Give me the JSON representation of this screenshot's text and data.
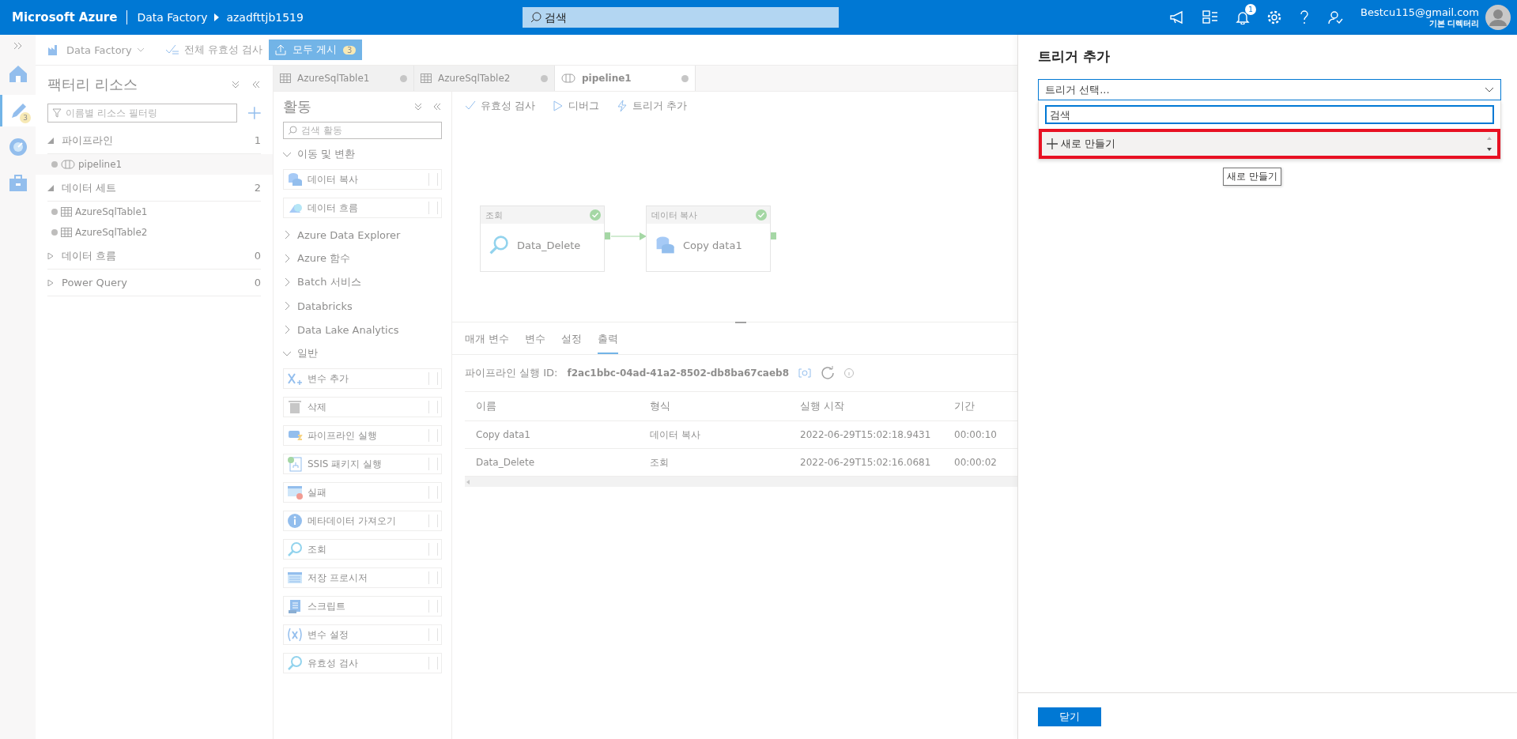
{
  "topbar": {
    "brand": "Microsoft Azure",
    "breadcrumb": [
      "Data Factory",
      "azadfttjb1519"
    ],
    "search_placeholder": "검색",
    "notification_count": "1",
    "user_email": "Bestcu115@gmail.com",
    "user_directory": "기본 디렉터리"
  },
  "rail": [
    {
      "kind": "home",
      "selected": false
    },
    {
      "kind": "author",
      "selected": true,
      "badge": "3"
    },
    {
      "kind": "monitor",
      "selected": false
    },
    {
      "kind": "manage",
      "selected": false
    }
  ],
  "toolbar": {
    "factory": "Data Factory",
    "validate_all": "전체 유효성 검사",
    "publish_all": "모두 게시",
    "publish_count": "3"
  },
  "factory_resources": {
    "title": "팩터리 리소스",
    "filter_placeholder": "이름별 리소스 필터링",
    "groups": [
      {
        "name": "파이프라인",
        "count": "1",
        "expanded": true,
        "children": [
          {
            "name": "pipeline1",
            "kind": "pipeline",
            "selected": true
          }
        ]
      },
      {
        "name": "데이터 세트",
        "count": "2",
        "expanded": true,
        "children": [
          {
            "name": "AzureSqlTable1",
            "kind": "dataset",
            "selected": false
          },
          {
            "name": "AzureSqlTable2",
            "kind": "dataset",
            "selected": false
          }
        ]
      },
      {
        "name": "데이터 흐름",
        "count": "0",
        "expanded": false
      },
      {
        "name": "Power Query",
        "count": "0",
        "expanded": false
      }
    ]
  },
  "tabs": [
    {
      "label": "AzureSqlTable1",
      "kind": "dataset",
      "selected": false
    },
    {
      "label": "AzureSqlTable2",
      "kind": "dataset",
      "selected": false
    },
    {
      "label": "pipeline1",
      "kind": "pipeline",
      "selected": true
    }
  ],
  "activities": {
    "title": "활동",
    "search_placeholder": "검색 활동",
    "categories": [
      {
        "name": "이동 및 변환",
        "expanded": true,
        "children": [
          {
            "name": "데이터 복사",
            "kind": "copy"
          },
          {
            "name": "데이터 흐름",
            "kind": "dataflow"
          }
        ]
      },
      {
        "name": "Azure Data Explorer",
        "expanded": false
      },
      {
        "name": "Azure 함수",
        "expanded": false
      },
      {
        "name": "Batch 서비스",
        "expanded": false
      },
      {
        "name": "Databricks",
        "expanded": false
      },
      {
        "name": "Data Lake Analytics",
        "expanded": false
      },
      {
        "name": "일반",
        "expanded": true,
        "children": [
          {
            "name": "변수 추가",
            "kind": "append"
          },
          {
            "name": "삭제",
            "kind": "delete"
          },
          {
            "name": "파이프라인 실행",
            "kind": "execute"
          },
          {
            "name": "SSIS 패키지 실행",
            "kind": "ssis"
          },
          {
            "name": "실패",
            "kind": "fail"
          },
          {
            "name": "메타데이터 가져오기",
            "kind": "metadata"
          },
          {
            "name": "조회",
            "kind": "lookup"
          },
          {
            "name": "저장 프로시저",
            "kind": "procedure"
          },
          {
            "name": "스크립트",
            "kind": "script"
          },
          {
            "name": "변수 설정",
            "kind": "setvar"
          },
          {
            "name": "유효성 검사",
            "kind": "lookup"
          }
        ]
      }
    ]
  },
  "canvas_toolbar": [
    {
      "label": "유효성 검사",
      "kind": "validate"
    },
    {
      "label": "디버그",
      "kind": "debug"
    },
    {
      "label": "트리거 추가",
      "kind": "trigger"
    }
  ],
  "nodes": [
    {
      "type_label": "조회",
      "name": "Data_Delete",
      "kind": "lookup",
      "succeeded": true
    },
    {
      "type_label": "데이터 복사",
      "name": "Copy data1",
      "kind": "copy",
      "succeeded": true
    }
  ],
  "output": {
    "tabs": [
      {
        "label": "매개 변수",
        "selected": false
      },
      {
        "label": "변수",
        "selected": false
      },
      {
        "label": "설정",
        "selected": false
      },
      {
        "label": "출력",
        "selected": true
      }
    ],
    "run_id_label": "파이프라인 실행 ID:",
    "run_id": "f2ac1bbc-04ad-41a2-8502-db8ba67caeb8",
    "columns": [
      "이름",
      "형식",
      "실행 시작",
      "기간"
    ],
    "rows": [
      [
        "Copy data1",
        "데이터 복사",
        "2022-06-29T15:02:18.9431",
        "00:00:10"
      ],
      [
        "Data_Delete",
        "조회",
        "2022-06-29T15:02:16.0681",
        "00:00:02"
      ]
    ]
  },
  "trigger_panel": {
    "title": "트리거 추가",
    "select_placeholder": "트리거 선택...",
    "search_placeholder": "검색",
    "options": [
      {
        "label": "새로 만들기",
        "kind": "new",
        "highlighted": true
      }
    ],
    "tooltip": "새로 만들기",
    "close": "닫기"
  }
}
